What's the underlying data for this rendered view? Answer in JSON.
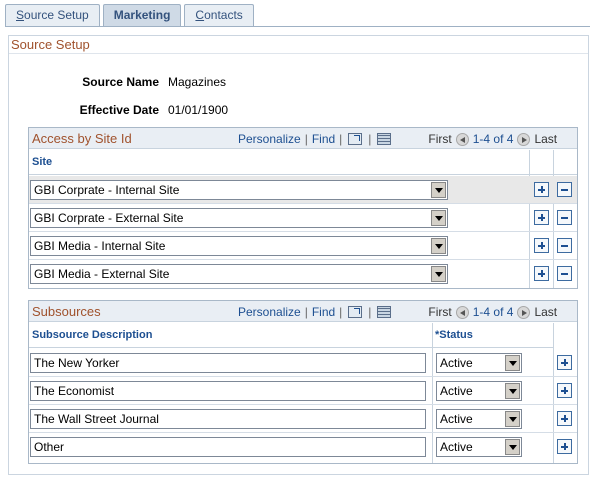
{
  "tabs": [
    {
      "label": "Source Setup",
      "underline_char": "S",
      "rest": "ource Setup",
      "active": false
    },
    {
      "label": "Marketing",
      "active": true
    },
    {
      "label": "Contacts",
      "underline_char": "C",
      "rest": "ontacts",
      "active": false
    }
  ],
  "section": {
    "title": "Source Setup",
    "fields": {
      "source_name_label": "Source Name",
      "source_name_value": "Magazines",
      "effective_date_label": "Effective Date",
      "effective_date_value": "01/01/1900"
    }
  },
  "access_grid": {
    "title": "Access by Site Id",
    "personalize": "Personalize",
    "find": "Find",
    "first": "First",
    "range": "1-4 of 4",
    "last": "Last",
    "column": "Site",
    "rows": [
      {
        "site": "GBI Corprate - Internal Site"
      },
      {
        "site": "GBI Corprate - External Site"
      },
      {
        "site": "GBI Media - Internal Site"
      },
      {
        "site": "GBI Media - External Site"
      }
    ]
  },
  "subsources_grid": {
    "title": "Subsources",
    "personalize": "Personalize",
    "find": "Find",
    "first": "First",
    "range": "1-4 of 4",
    "last": "Last",
    "col_description": "Subsource Description",
    "col_status": "*Status",
    "rows": [
      {
        "description": "The New Yorker",
        "status": "Active"
      },
      {
        "description": "The Economist",
        "status": "Active"
      },
      {
        "description": "The Wall Street Journal",
        "status": "Active"
      },
      {
        "description": "Other",
        "status": "Active"
      }
    ]
  }
}
